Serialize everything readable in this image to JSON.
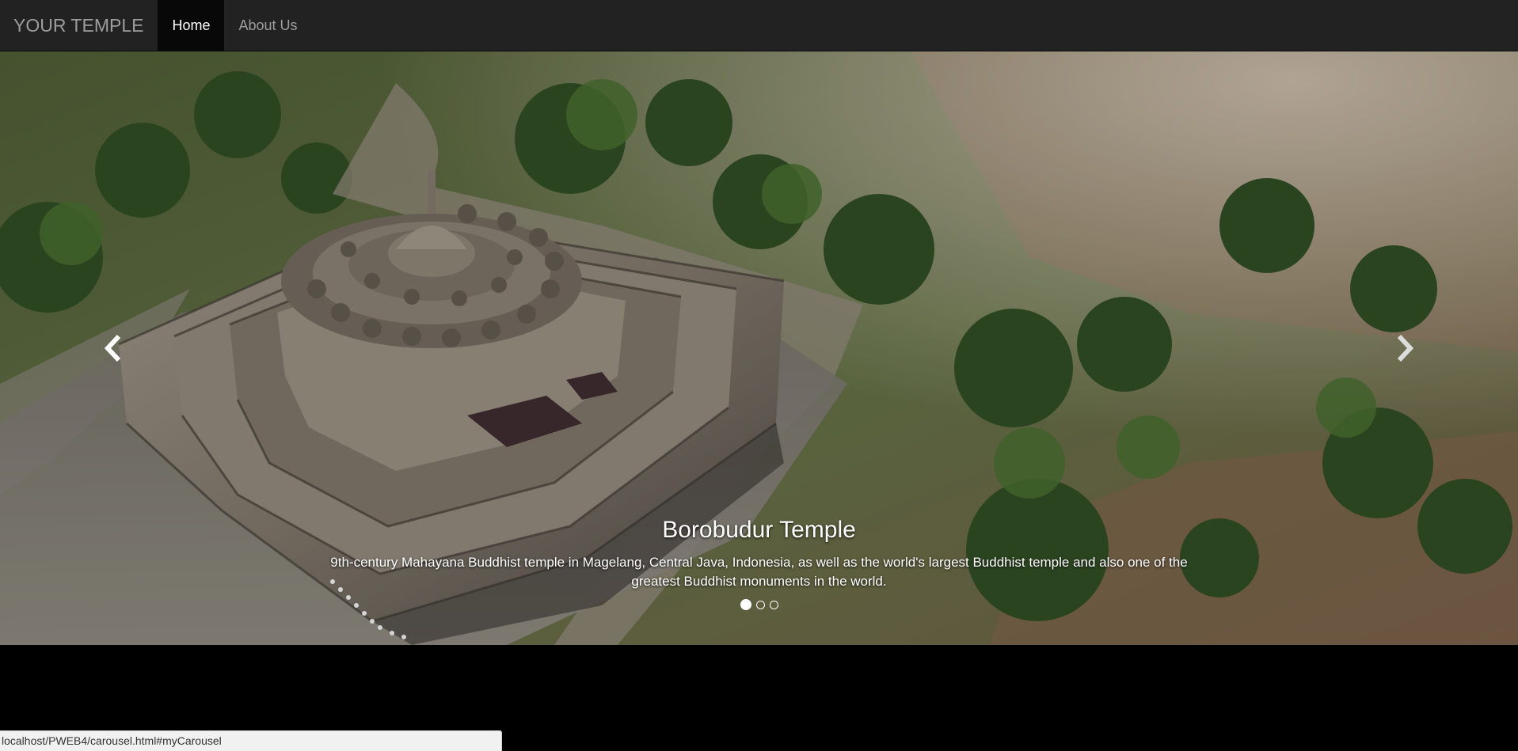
{
  "navbar": {
    "brand": "YOUR TEMPLE",
    "items": [
      {
        "label": "Home",
        "active": true
      },
      {
        "label": "About Us",
        "active": false
      }
    ]
  },
  "carousel": {
    "slides_count": 3,
    "active_index": 0,
    "caption": {
      "title": "Borobudur Temple",
      "text": "9th-century Mahayana Buddhist temple in Magelang, Central Java, Indonesia, as well as the world's largest Buddhist temple and also one of the greatest Buddhist monuments in the world."
    },
    "prev_icon": "chevron-left-icon",
    "next_icon": "chevron-right-icon"
  },
  "status_bar": {
    "url": "localhost/PWEB4/carousel.html#myCarousel"
  },
  "colors": {
    "navbar_bg": "#222222",
    "navbar_active_bg": "#080808",
    "nav_text": "#9d9d9d",
    "page_bg": "#000000"
  }
}
